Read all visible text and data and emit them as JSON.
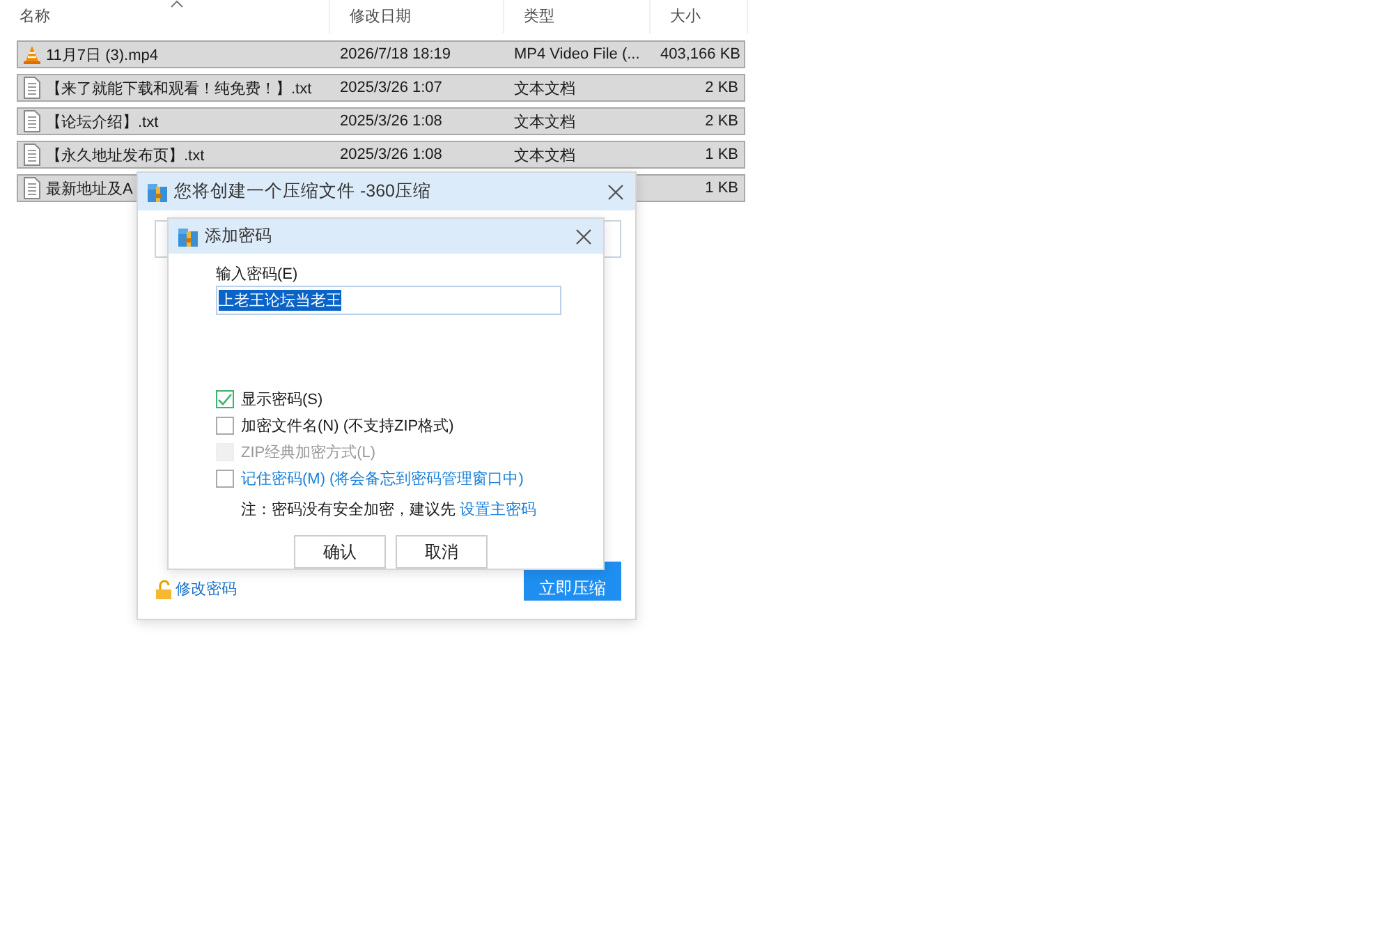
{
  "file_list": {
    "columns": [
      {
        "label": "名称",
        "sorted": true
      },
      {
        "label": "修改日期",
        "sorted": false
      },
      {
        "label": "类型",
        "sorted": false
      },
      {
        "label": "大小",
        "sorted": false
      }
    ],
    "rows": [
      {
        "kind": "video",
        "name": "11月7日 (3).mp4",
        "date": "2026/7/18 18:19",
        "type": "MP4 Video File (...",
        "size": "403,166 KB",
        "selected": true
      },
      {
        "kind": "text",
        "name": "【来了就能下载和观看！纯免费！】.txt",
        "date": "2025/3/26 1:07",
        "type": "文本文档",
        "size": "2 KB",
        "selected": true
      },
      {
        "kind": "text",
        "name": "【论坛介绍】.txt",
        "date": "2025/3/26 1:08",
        "type": "文本文档",
        "size": "2 KB",
        "selected": true
      },
      {
        "kind": "text",
        "name": "【永久地址发布页】.txt",
        "date": "2025/3/26 1:08",
        "type": "文本文档",
        "size": "1 KB",
        "selected": true
      },
      {
        "kind": "text",
        "name": "最新地址及A",
        "size": "1 KB",
        "selected": true
      }
    ]
  },
  "zip_dialog": {
    "title": "您将创建一个压缩文件 -360压缩",
    "change_password_link": "修改密码",
    "compress_button": "立即压缩"
  },
  "password_dialog": {
    "title": "添加密码",
    "field_label": "输入密码(E)",
    "password": {
      "value": "上老王论坛当老王",
      "selected": true
    },
    "options": [
      {
        "kind": "option",
        "label": "显示密码(S)",
        "checked": true,
        "disabled": false
      },
      {
        "kind": "option",
        "label": "加密文件名(N) (不支持ZIP格式)",
        "checked": false,
        "disabled": false
      },
      {
        "kind": "option",
        "label": "ZIP经典加密方式(L)",
        "checked": false,
        "disabled": true
      },
      {
        "kind": "link",
        "label": "记住密码(M) (将会备忘到密码管理窗口中)",
        "checked": false,
        "disabled": false
      }
    ],
    "note": "注：密码没有安全加密，建议先",
    "note_link": "设置主密码",
    "buttons": [
      "确认",
      "取消"
    ]
  }
}
